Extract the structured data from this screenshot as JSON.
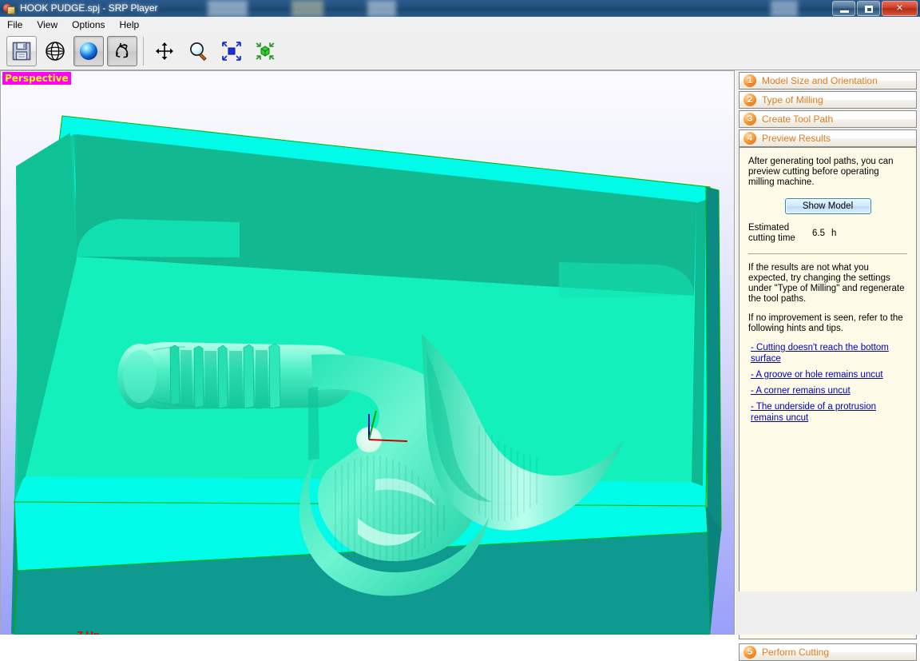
{
  "window": {
    "title": "HOOK PUDGE.spj - SRP Player",
    "icon": "app-icon",
    "buttons": {
      "minimize": "minimize",
      "maximize": "maximize",
      "close": "✕"
    }
  },
  "menubar": {
    "items": [
      {
        "label": "File"
      },
      {
        "label": "View"
      },
      {
        "label": "Options"
      },
      {
        "label": "Help"
      }
    ]
  },
  "toolbar": {
    "buttons": [
      {
        "name": "save-icon",
        "state": "framed"
      },
      {
        "name": "globe-icon",
        "state": "flat"
      },
      {
        "name": "shading-sphere-icon",
        "state": "active"
      },
      {
        "name": "rotate-icon",
        "state": "active"
      },
      {
        "name": "pan-move-icon",
        "state": "flat"
      },
      {
        "name": "zoom-magnifier-icon",
        "state": "flat"
      },
      {
        "name": "zoom-to-fit-icon",
        "state": "flat"
      },
      {
        "name": "fit-object-icon",
        "state": "flat"
      }
    ]
  },
  "viewport": {
    "view_label": "Perspective",
    "view_label_colors": {
      "background": "#ff00ff",
      "text": "#ffff00"
    },
    "background_top": "#fbfbff",
    "background_bottom": "#9a9ffb",
    "model_colors": {
      "top_surface": "#00ffe0",
      "pocket_floor": "#00e8b4",
      "pocket_wall": "#10b589",
      "side_face": "#0e8f86",
      "outline": "#00b400"
    },
    "axis_gizmo": {
      "x_color": "#cc0000",
      "y_color": "#00a000",
      "z_color": "#0000cc"
    },
    "bottom_text": "Z Up"
  },
  "right_panel": {
    "steps": [
      {
        "number": "1",
        "label": "Model Size and Orientation"
      },
      {
        "number": "2",
        "label": "Type of Milling"
      },
      {
        "number": "3",
        "label": "Create Tool Path"
      },
      {
        "number": "4",
        "label": "Preview Results"
      }
    ],
    "body": {
      "intro": "After generating tool paths, you can preview cutting before operating milling machine.",
      "show_model_button": "Show Model",
      "estimated_time_label": "Estimated cutting time",
      "estimated_time_value": "6.5",
      "estimated_time_unit": "h",
      "hint_paragraph_1": "If the results are not what you expected, try changing the settings under \"Type of Milling\" and regenerate the tool paths.",
      "hint_paragraph_2": "If no improvement is seen, refer to the following hints and tips.",
      "links": [
        "- Cutting doesn't reach the bottom surface",
        "- A groove or hole remains uncut",
        "- A corner remains uncut",
        "- The underside of a protrusion remains uncut"
      ]
    },
    "perform_cutting": {
      "number": "5",
      "label": "Perform Cutting"
    }
  }
}
